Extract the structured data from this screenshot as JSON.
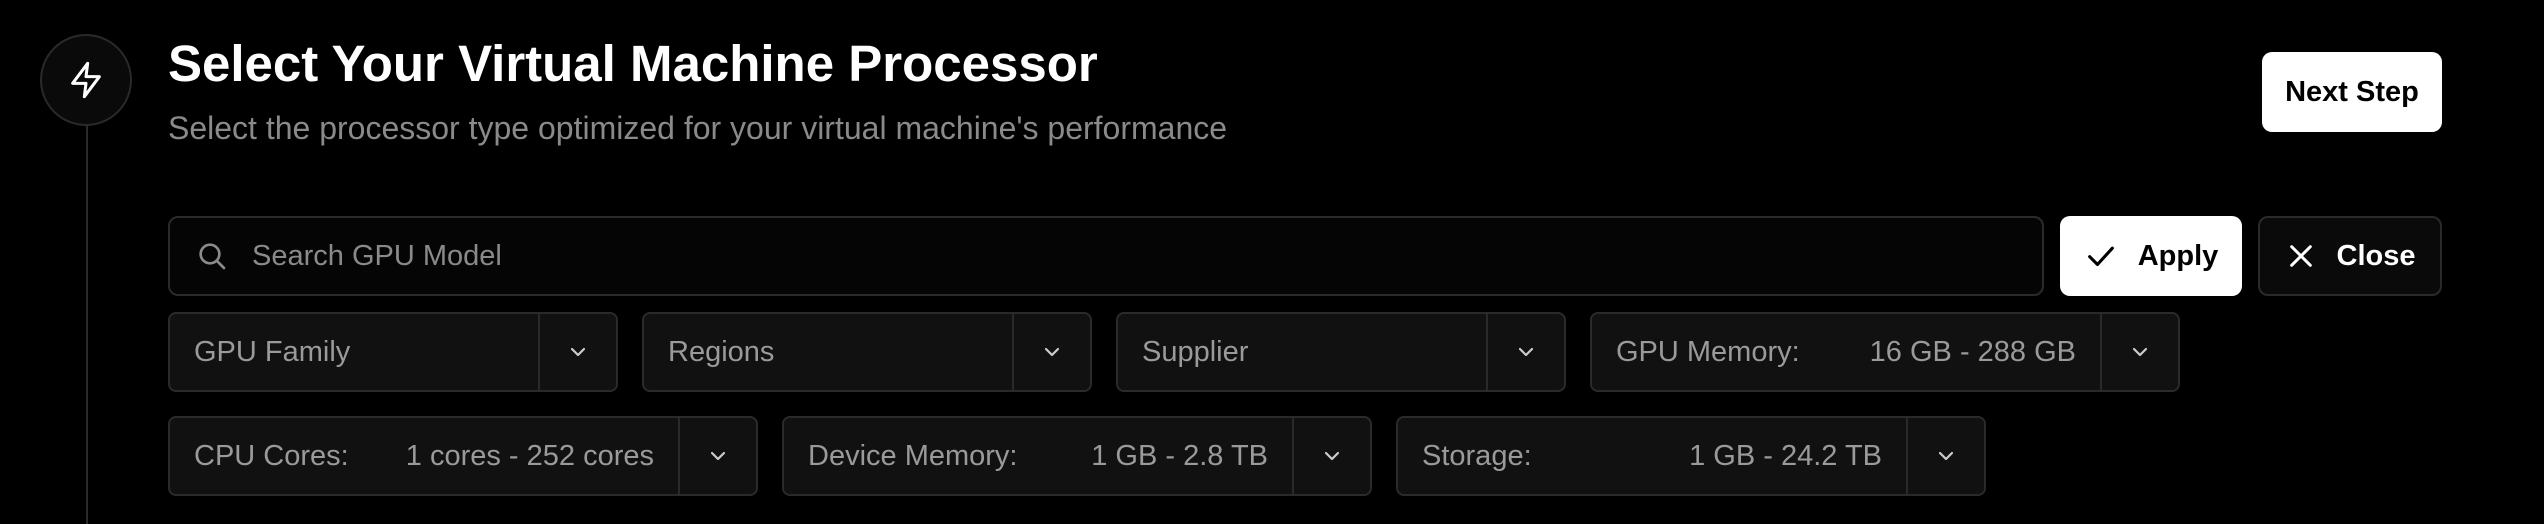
{
  "header": {
    "title": "Select Your Virtual Machine Processor",
    "subtitle": "Select the processor type optimized for your virtual machine's performance",
    "step_icon": "lightning-icon",
    "next_label": "Next Step"
  },
  "search": {
    "placeholder": "Search GPU Model",
    "value": "",
    "icon": "search-icon"
  },
  "actions": {
    "apply_label": "Apply",
    "apply_icon": "check-icon",
    "close_label": "Close",
    "close_icon": "close-icon"
  },
  "filters": {
    "gpu_family": {
      "label": "GPU Family"
    },
    "regions": {
      "label": "Regions"
    },
    "supplier": {
      "label": "Supplier"
    },
    "gpu_memory": {
      "label": "GPU Memory:",
      "value": "16 GB - 288 GB"
    },
    "cpu_cores": {
      "label": "CPU Cores:",
      "value": "1 cores - 252 cores"
    },
    "device_memory": {
      "label": "Device Memory:",
      "value": "1 GB - 2.8 TB"
    },
    "storage": {
      "label": "Storage:",
      "value": "1 GB - 24.2 TB"
    }
  },
  "colors": {
    "background": "#000000",
    "border": "#2a2a2a",
    "muted_text": "#8a8a8a",
    "primary_button": "#ffffff"
  }
}
